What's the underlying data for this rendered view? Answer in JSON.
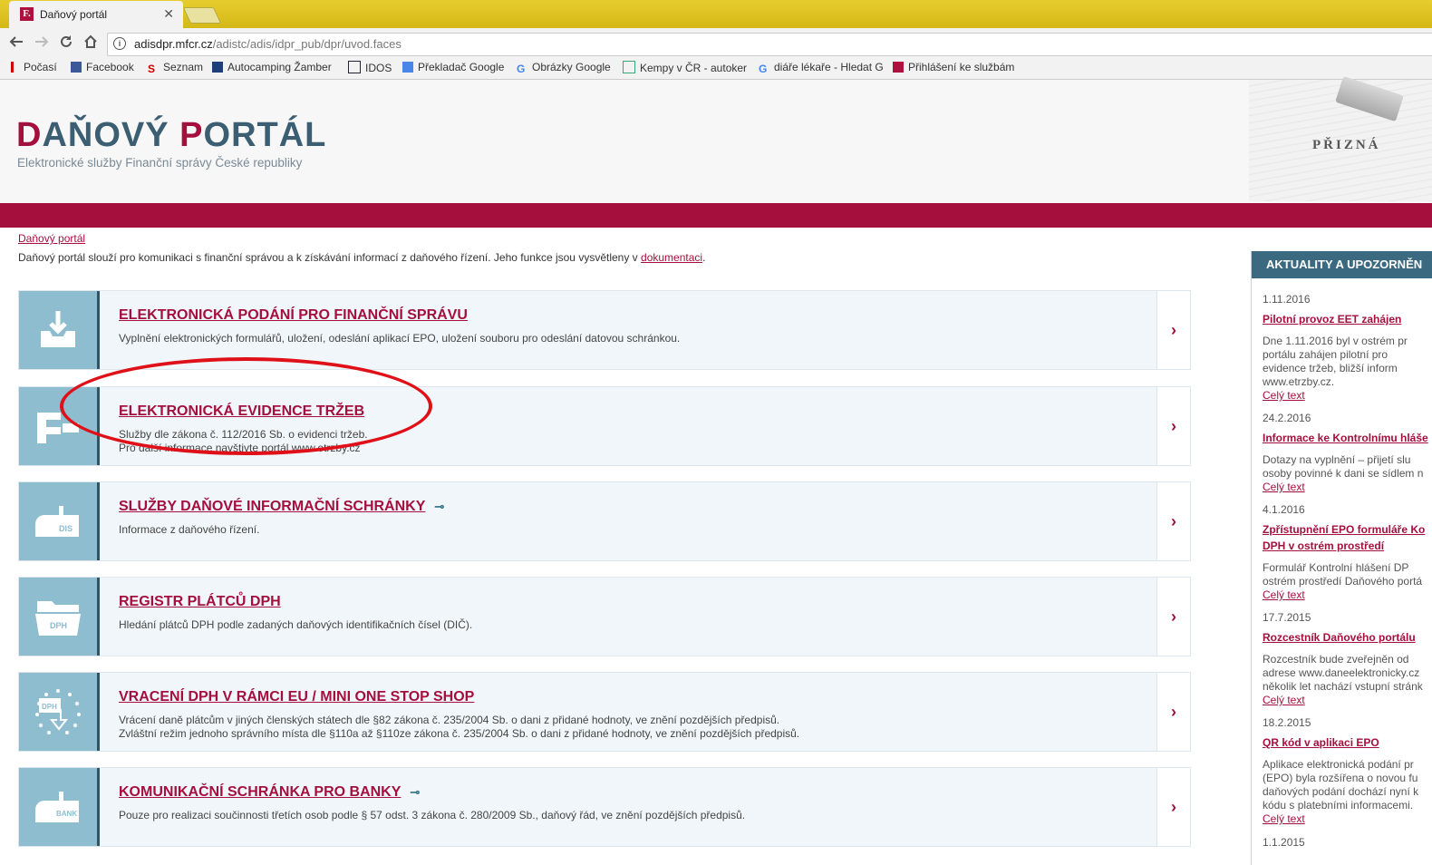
{
  "browser": {
    "tab_title": "Daňový portál",
    "tab_favicon": "F.",
    "close_glyph": "✕",
    "url_host": "adisdpr.mfcr.cz",
    "url_path": "/adistc/adis/idpr_pub/dpr/uvod.faces",
    "bookmarks": [
      {
        "label": "Počasí",
        "icon": "weather-icon"
      },
      {
        "label": "Facebook",
        "icon": "facebook-icon"
      },
      {
        "label": "Seznam",
        "icon": "seznam-icon"
      },
      {
        "label": "Autocamping Žamber",
        "icon": "autocamping-icon"
      },
      {
        "label": "IDOS",
        "icon": "idos-icon"
      },
      {
        "label": "Překladač Google",
        "icon": "google-translate-icon"
      },
      {
        "label": "Obrázky Google",
        "icon": "google-icon"
      },
      {
        "label": "Kempy v ČR - autoker",
        "icon": "kempy-icon"
      },
      {
        "label": "diáře lékaře - Hledat G",
        "icon": "google-icon"
      },
      {
        "label": "Přihlášení ke službám",
        "icon": "mfcr-icon"
      }
    ]
  },
  "header": {
    "logo_d": "D",
    "logo_mid": "AŇOVÝ ",
    "logo_p": "P",
    "logo_end": "ORTÁL",
    "subtitle": "Elektronické služby Finanční správy České republiky",
    "image_text": "PŘIZNÁ"
  },
  "breadcrumb": "Daňový portál",
  "intro": {
    "text": "Daňový portál slouží pro komunikaci s finanční správou a k získávání informací z daňového řízení. Jeho funkce jsou vysvětleny v ",
    "link": "dokumentaci",
    "end": "."
  },
  "cards": [
    {
      "title": "ELEKTRONICKÁ PODÁNÍ PRO FINANČNÍ SPRÁVU",
      "desc1": "Vyplnění elektronických formulářů, uložení, odeslání aplikací EPO, uložení souboru pro odeslání datovou schránkou.",
      "desc2": "",
      "icon": "inbox-download-icon"
    },
    {
      "title": "ELEKTRONICKÁ EVIDENCE TRŽEB",
      "desc1": "Služby dle zákona č. 112/2016 Sb. o evidenci tržeb.",
      "desc2": "Pro další informace navštivte portál www.etrzby.cz",
      "icon": "eet-icon"
    },
    {
      "title": "SLUŽBY DAŇOVÉ INFORMAČNÍ SCHRÁNKY",
      "desc1": "Informace z daňového řízení.",
      "desc2": "",
      "icon": "mailbox-dis-icon",
      "mailbox_label": "DIS"
    },
    {
      "title": "REGISTR PLÁTCŮ DPH",
      "desc1": "Hledání plátců DPH podle zadaných daňových identifikačních čísel (DIČ).",
      "desc2": "",
      "icon": "folder-dph-icon",
      "folder_label": "DPH"
    },
    {
      "title": "VRACENÍ DPH V RÁMCI EU / MINI ONE STOP SHOP",
      "desc1": "Vrácení daně plátcům v jiných členských státech dle §82 zákona č. 235/2004 Sb. o dani z přidané hodnoty, ve znění pozdějších předpisů.",
      "desc2": "Zvláštní režim jednoho správního místa dle §110a až §110ze zákona č. 235/2004 Sb. o dani z přidané hodnoty, ve znění pozdějších předpisů.",
      "icon": "eu-dph-icon",
      "eu_label": "DPH"
    },
    {
      "title": "KOMUNIKAČNÍ SCHRÁNKA PRO BANKY",
      "desc1": "Pouze pro realizaci součinnosti třetích osob podle § 57 odst. 3 zákona č. 280/2009 Sb., daňový řád, ve znění pozdějších předpisů.",
      "desc2": "",
      "icon": "mailbox-bank-icon",
      "mailbox_label": "BANK"
    }
  ],
  "arrow_glyph": "›",
  "key_glyph": "⊸",
  "news": {
    "heading": "AKTUALITY A UPOZORNĚN",
    "more": "Celý text",
    "items": [
      {
        "date": "1.11.2016",
        "title": "Pilotní provoz EET zahájen",
        "title2": "",
        "lines": [
          "Dne 1.11.2016 byl v ostrém pr",
          "portálu zahájen pilotní pro",
          "evidence tržeb, bližší inform",
          "www.etrzby.cz."
        ]
      },
      {
        "date": "24.2.2016",
        "title": "Informace ke Kontrolnímu hláše",
        "title2": "",
        "lines": [
          "Dotazy na vyplnění – přijetí slu",
          "osoby povinné k dani se sídlem n"
        ]
      },
      {
        "date": "4.1.2016",
        "title": "Zpřístupnění EPO formuláře Ko",
        "title2": "DPH v ostrém prostředí",
        "lines": [
          "Formulář Kontrolní hlášení DP",
          "ostrém prostředí Daňového portá"
        ]
      },
      {
        "date": "17.7.2015",
        "title": "Rozcestník Daňového portálu",
        "title2": "",
        "lines": [
          "Rozcestník bude zveřejněn od",
          "adrese www.daneelektronicky.cz",
          "několik let nachází vstupní stránk"
        ]
      },
      {
        "date": "18.2.2015",
        "title": "QR kód v aplikaci EPO",
        "title2": "",
        "lines": [
          "Aplikace elektronická podání pr",
          "(EPO) byla rozšířena o novou fu",
          "daňových podání dochází nyní k",
          "kódu s platebními informacemi."
        ]
      },
      {
        "date": "1.1.2015",
        "title": "",
        "title2": "",
        "lines": []
      }
    ]
  }
}
